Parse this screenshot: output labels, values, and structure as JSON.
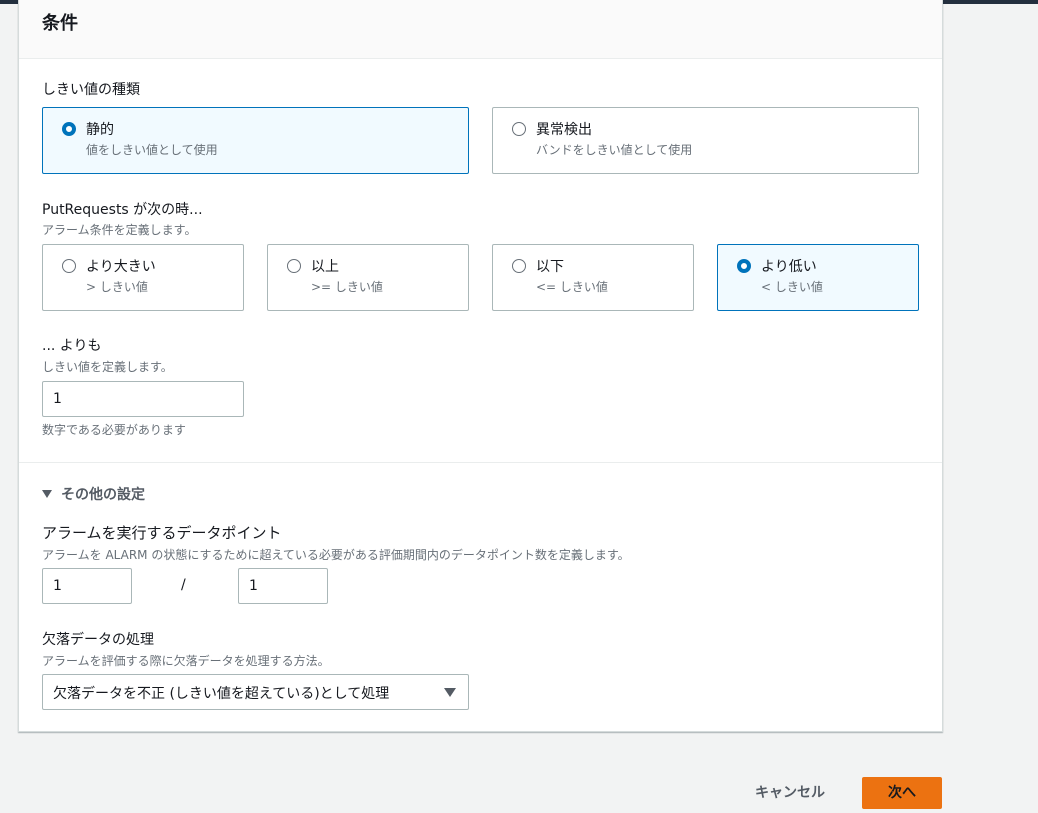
{
  "panel": {
    "title": "条件"
  },
  "threshold_type": {
    "label": "しきい値の種類",
    "options": [
      {
        "title": "静的",
        "sub": "値をしきい値として使用",
        "selected": true
      },
      {
        "title": "異常検出",
        "sub": "バンドをしきい値として使用",
        "selected": false
      }
    ]
  },
  "condition": {
    "label": "PutRequests が次の時...",
    "desc": "アラーム条件を定義します。",
    "options": [
      {
        "title": "より大きい",
        "sub": "> しきい値",
        "selected": false
      },
      {
        "title": "以上",
        "sub": ">= しきい値",
        "selected": false
      },
      {
        "title": "以下",
        "sub": "<= しきい値",
        "selected": false
      },
      {
        "title": "より低い",
        "sub": "< しきい値",
        "selected": true
      }
    ]
  },
  "threshold": {
    "label": "... よりも",
    "desc": "しきい値を定義します。",
    "value": "1",
    "hint": "数字である必要があります"
  },
  "additional": {
    "label": "その他の設定"
  },
  "datapoints": {
    "label": "アラームを実行するデータポイント",
    "desc": "アラームを ALARM の状態にするために超えている必要がある評価期間内のデータポイント数を定義します。",
    "value_a": "1",
    "separator": "/",
    "value_b": "1"
  },
  "missing_data": {
    "label": "欠落データの処理",
    "desc": "アラームを評価する際に欠落データを処理する方法。",
    "selected": "欠落データを不正 (しきい値を超えている)として処理"
  },
  "footer": {
    "cancel": "キャンセル",
    "next": "次へ"
  },
  "colors": {
    "accent": "#0073bb",
    "primary_button": "#ec7211",
    "selected_tile_bg": "#f1faff"
  }
}
